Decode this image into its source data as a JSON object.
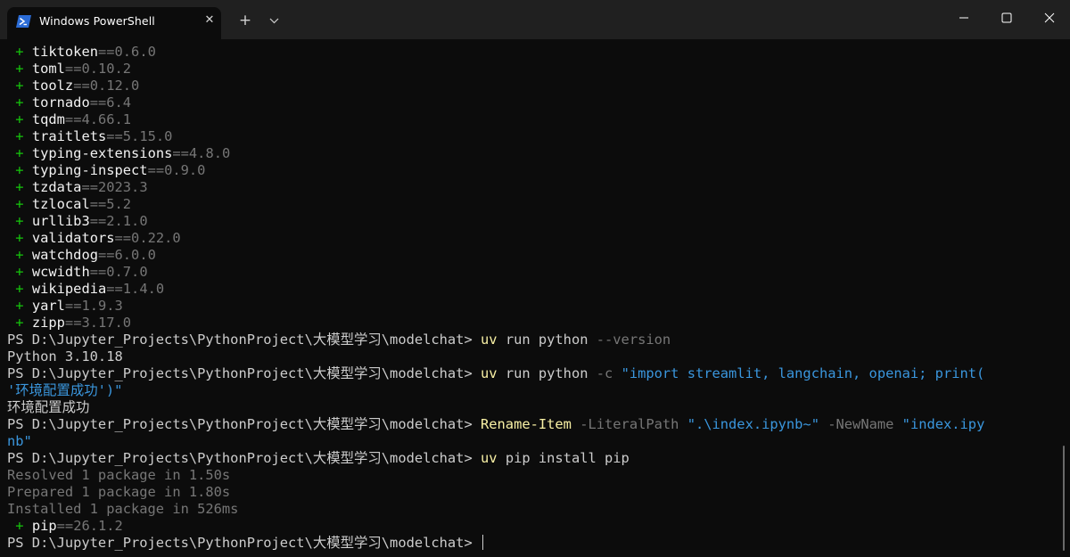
{
  "titlebar": {
    "tab_title": "Windows PowerShell",
    "tab_close_glyph": "✕",
    "new_tab_glyph": "+",
    "dropdown_glyph": "⌄",
    "icons": {
      "tab": "powershell-icon",
      "minimize": "minimize-icon",
      "maximize": "maximize-icon",
      "close": "close-icon"
    }
  },
  "colors": {
    "background": "#0c0c0c",
    "titlebar": "#202020",
    "plus": "#16c60c",
    "command": "#f9f1a5",
    "string": "#3a96dd",
    "dim": "#767676",
    "text": "#cccccc"
  },
  "terminal": {
    "packages": [
      {
        "plus": "+",
        "name": "tiktoken",
        "version": "==0.6.0"
      },
      {
        "plus": "+",
        "name": "toml",
        "version": "==0.10.2"
      },
      {
        "plus": "+",
        "name": "toolz",
        "version": "==0.12.0"
      },
      {
        "plus": "+",
        "name": "tornado",
        "version": "==6.4"
      },
      {
        "plus": "+",
        "name": "tqdm",
        "version": "==4.66.1"
      },
      {
        "plus": "+",
        "name": "traitlets",
        "version": "==5.15.0"
      },
      {
        "plus": "+",
        "name": "typing-extensions",
        "version": "==4.8.0"
      },
      {
        "plus": "+",
        "name": "typing-inspect",
        "version": "==0.9.0"
      },
      {
        "plus": "+",
        "name": "tzdata",
        "version": "==2023.3"
      },
      {
        "plus": "+",
        "name": "tzlocal",
        "version": "==5.2"
      },
      {
        "plus": "+",
        "name": "urllib3",
        "version": "==2.1.0"
      },
      {
        "plus": "+",
        "name": "validators",
        "version": "==0.22.0"
      },
      {
        "plus": "+",
        "name": "watchdog",
        "version": "==6.0.0"
      },
      {
        "plus": "+",
        "name": "wcwidth",
        "version": "==0.7.0"
      },
      {
        "plus": "+",
        "name": "wikipedia",
        "version": "==1.4.0"
      },
      {
        "plus": "+",
        "name": "yarl",
        "version": "==1.9.3"
      },
      {
        "plus": "+",
        "name": "zipp",
        "version": "==3.17.0"
      }
    ],
    "prompt": "PS D:\\Jupyter_Projects\\PythonProject\\大模型学习\\modelchat> ",
    "cmd1": {
      "exe": "uv",
      "args": " run python ",
      "flag": "--version"
    },
    "out1": "Python 3.10.18",
    "cmd2": {
      "exe": "uv",
      "args": " run python ",
      "flag": "-c",
      "str_part1": "\"import streamlit, langchain, openai; print(",
      "str_part2": "'环境配置成功')\""
    },
    "out2": "环境配置成功",
    "cmd3": {
      "exe": "Rename-Item",
      "flag1": "-LiteralPath",
      "str1": "\".\\index.ipynb~\"",
      "flag2": "-NewName",
      "str2_part1": "\"index.ipy",
      "str2_part2": "nb\""
    },
    "cmd4": {
      "exe": "uv",
      "args": " pip install pip"
    },
    "out4": [
      "Resolved 1 package in 1.50s",
      "Prepared 1 package in 1.80s",
      "Installed 1 package in 526ms"
    ],
    "final_package": {
      "plus": "+",
      "name": "pip",
      "version": "==26.1.2"
    }
  }
}
